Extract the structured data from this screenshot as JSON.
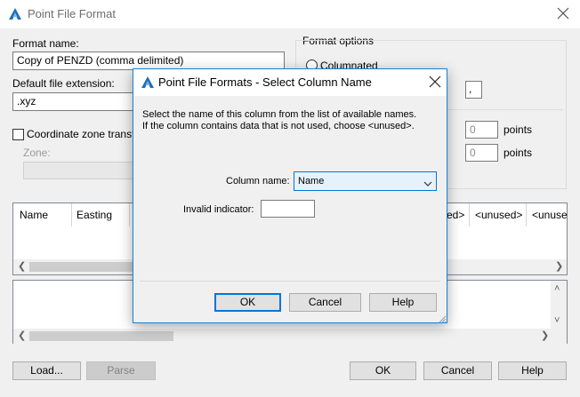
{
  "main_dialog": {
    "title": "Point File Format",
    "format_name_label": "Format name:",
    "format_name_value": "Copy of PENZD (comma delimited)",
    "default_extension_label": "Default file extension:",
    "default_extension_value": ".xyz",
    "coordinate_zone_label": "Coordinate zone transfor",
    "zone_label": "Zone:",
    "zone_value": "",
    "format_options_label": "Format options",
    "columnated_label": "Columnated",
    "delimiter_value": ",",
    "points_value_1": "0",
    "points_label_1": "points",
    "points_value_2": "0",
    "points_label_2": "points",
    "columns_left": [
      "Name",
      "Easting"
    ],
    "columns_right": [
      "ed>",
      "<unused>",
      "<unuse"
    ],
    "buttons": {
      "load": "Load...",
      "parse": "Parse",
      "ok": "OK",
      "cancel": "Cancel",
      "help": "Help"
    }
  },
  "modal": {
    "title": "Point File Formats - Select Column Name",
    "instructions_line1": "Select the name of this column from the list of available names.",
    "instructions_line2": "If the column contains data that is not used, choose <unused>.",
    "column_name_label": "Column name:",
    "column_name_value": "Name",
    "invalid_indicator_label": "Invalid indicator:",
    "invalid_indicator_value": "",
    "buttons": {
      "ok": "OK",
      "cancel": "Cancel",
      "help": "Help"
    }
  },
  "icons": {
    "app_icon": "autodesk-civil-icon",
    "close": "close-icon",
    "dropdown": "chevron-down-icon"
  },
  "colors": {
    "accent": "#0078d7",
    "modal_border": "#1883d7",
    "app_icon_blue": "#1e6fb8",
    "combo_fill": "#e5f1fb"
  }
}
